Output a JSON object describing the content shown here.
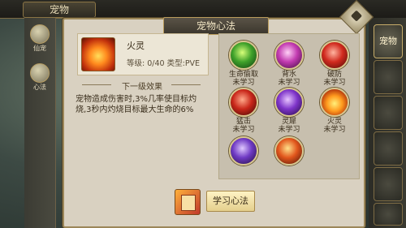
{
  "header": {
    "title": "宠物"
  },
  "left_menu": [
    {
      "label": "仙宠",
      "icon": "pet-spirit-icon"
    },
    {
      "label": "心法",
      "icon": "scroll-icon"
    }
  ],
  "right_tabs": [
    "宠物",
    "",
    "",
    "",
    "",
    ""
  ],
  "panel": {
    "title": "宠物心法"
  },
  "selected_skill": {
    "name": "火灵",
    "level_label": "等级:",
    "level_value": "0/40",
    "type_label": "类型:",
    "type_value": "PVE"
  },
  "next_effect": {
    "title": "下一级效果",
    "text": "宠物造成伤害时,3%几率使目标灼烧,3秒内灼烧目标最大生命的6%"
  },
  "skills": [
    {
      "name": "生命偷取",
      "status": "未学习",
      "color": "green"
    },
    {
      "name": "背水",
      "status": "未学习",
      "color": "magenta"
    },
    {
      "name": "破防",
      "status": "未学习",
      "color": "red"
    },
    {
      "name": "猛击",
      "status": "未学习",
      "color": "red"
    },
    {
      "name": "灵犀",
      "status": "未学习",
      "color": "purple"
    },
    {
      "name": "火灵",
      "status": "未学习",
      "color": "orange"
    },
    {
      "name": "",
      "status": "",
      "color": "purple"
    },
    {
      "name": "",
      "status": "",
      "color": "orange-red"
    }
  ],
  "learn_button": {
    "label": "学习心法"
  }
}
